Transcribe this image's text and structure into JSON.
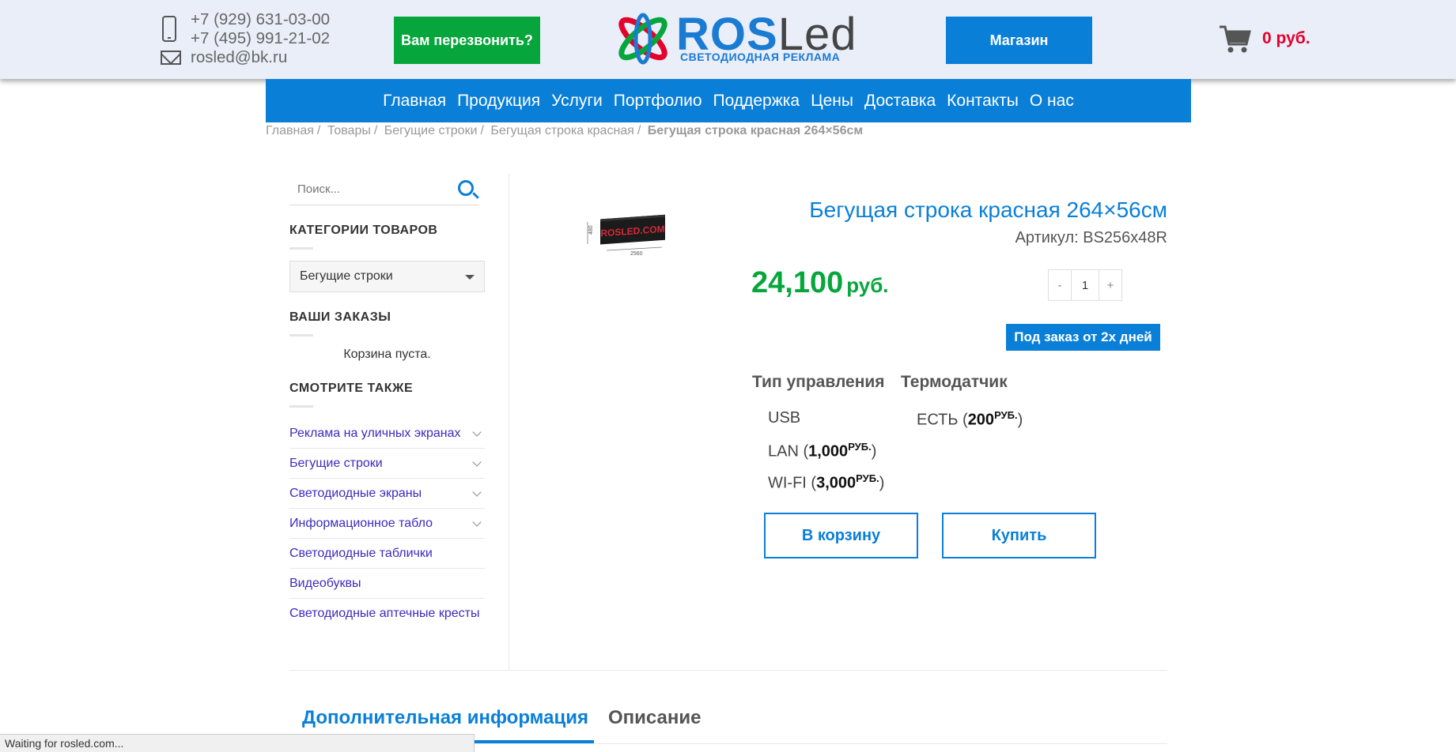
{
  "header": {
    "phone1": "+7 (929) 631-03-00",
    "phone2": "+7 (495) 991-21-02",
    "email": "rosled@bk.ru",
    "call_button": "Вам перезвонить?",
    "logo_main_1": "ROS",
    "logo_main_2": "Led",
    "logo_sub": "СВЕТОДИОДНАЯ РЕКЛАМА",
    "shop_button": "Магазин",
    "cart_total": "0 руб."
  },
  "nav": {
    "items": [
      "Главная",
      "Продукция",
      "Услуги",
      "Портфолио",
      "Поддержка",
      "Цены",
      "Доставка",
      "Контакты",
      "О нас"
    ]
  },
  "breadcrumb": {
    "items": [
      "Главная",
      "Товары",
      "Бегущие строки",
      "Бегущая строка красная"
    ],
    "separator": "/",
    "current": "Бегущая строка красная 264×56см"
  },
  "sidebar": {
    "search_placeholder": "Поиск...",
    "categories_title": "КАТЕГОРИИ ТОВАРОВ",
    "category_selected": "Бегущие строки",
    "orders_title": "ВАШИ ЗАКАЗЫ",
    "cart_empty": "Корзина пуста.",
    "see_also_title": "СМОТРИТЕ ТАКЖЕ",
    "see_also": [
      {
        "label": "Реклама на уличных экранах",
        "expandable": true
      },
      {
        "label": "Бегущие строки",
        "expandable": true
      },
      {
        "label": "Светодиодные экраны",
        "expandable": true
      },
      {
        "label": "Информационное табло",
        "expandable": true
      },
      {
        "label": "Светодиодные таблички",
        "expandable": false
      },
      {
        "label": "Видеобуквы",
        "expandable": false
      },
      {
        "label": "Светодиодные аптечные кресты",
        "expandable": false
      }
    ]
  },
  "product": {
    "title": "Бегущая строка красная 264×56см",
    "sku": "Артикул: BS256x48R",
    "price": "24,100",
    "currency": "руб.",
    "qty_minus": "-",
    "qty": "1",
    "qty_plus": "+",
    "badge": "Под заказ от 2х дней",
    "thumb_text": "ROSLED.COM",
    "thumb_dim_w": "2560",
    "thumb_dim_h": "480",
    "control_title": "Тип управления",
    "control_options": [
      {
        "label": "USB",
        "price": null
      },
      {
        "label": "LAN",
        "price": "1,000"
      },
      {
        "label": "WI-FI",
        "price": "3,000"
      }
    ],
    "sensor_title": "Термодатчик",
    "sensor_options": [
      {
        "label": "ЕСТЬ",
        "price": "200"
      }
    ],
    "price_unit": "РУБ.",
    "add_to_cart": "В корзину",
    "buy": "Купить"
  },
  "tabs": {
    "active": "Дополнительная информация",
    "second": "Описание"
  },
  "status_bar": "Waiting for rosled.com...",
  "colors": {
    "accent": "#0a7fd8",
    "green": "#07a63c",
    "red": "#e5002b"
  }
}
